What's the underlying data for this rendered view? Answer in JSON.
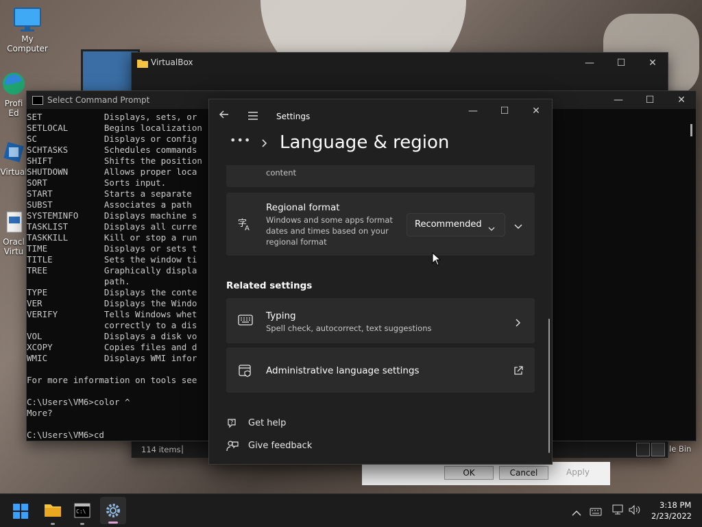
{
  "desktop": {
    "icons": [
      {
        "label": "My Computer"
      },
      {
        "label": "Profi Ed"
      },
      {
        "label": "Virtual"
      },
      {
        "label": "Oracl Virtu"
      }
    ],
    "recycle_label": "le Bin"
  },
  "virtualbox": {
    "title": "VirtualBox",
    "status_items": "114 items",
    "status_sep": "|"
  },
  "cmd": {
    "title": "Select Command Prompt",
    "lines": [
      "SET            Displays, sets, or",
      "SETLOCAL       Begins localization",
      "SC             Displays or config",
      "SCHTASKS       Schedules commands",
      "SHIFT          Shifts the position",
      "SHUTDOWN       Allows proper loca",
      "SORT           Sorts input.",
      "START          Starts a separate",
      "SUBST          Associates a path",
      "SYSTEMINFO     Displays machine s",
      "TASKLIST       Displays all curre",
      "TASKKILL       Kill or stop a run",
      "TIME           Displays or sets t",
      "TITLE          Sets the window ti",
      "TREE           Graphically displa",
      "               path.",
      "TYPE           Displays the conte",
      "VER            Displays the Windo",
      "VERIFY         Tells Windows whet",
      "               correctly to a dis",
      "VOL            Displays a disk vo",
      "XCOPY          Copies files and d",
      "WMIC           Displays WMI infor",
      "",
      "For more information on tools see",
      "",
      "C:\\Users\\VM6>color ^",
      "More?",
      "",
      "C:\\Users\\VM6>cd"
    ]
  },
  "dialog": {
    "ok": "OK",
    "cancel": "Cancel",
    "apply": "Apply"
  },
  "settings": {
    "app_title": "Settings",
    "page_title": "Language & region",
    "partial_card_text": "content",
    "regional": {
      "title": "Regional format",
      "desc_lines": [
        "Windows and some apps format",
        "dates and times based on your",
        "regional format"
      ],
      "dropdown_value": "Recommended"
    },
    "related_header": "Related settings",
    "typing": {
      "title": "Typing",
      "desc": "Spell check, autocorrect, text suggestions"
    },
    "admin": {
      "title": "Administrative language settings"
    },
    "help": "Get help",
    "feedback": "Give feedback"
  },
  "taskbar": {
    "time": "3:18 PM",
    "date": "2/23/2022"
  }
}
